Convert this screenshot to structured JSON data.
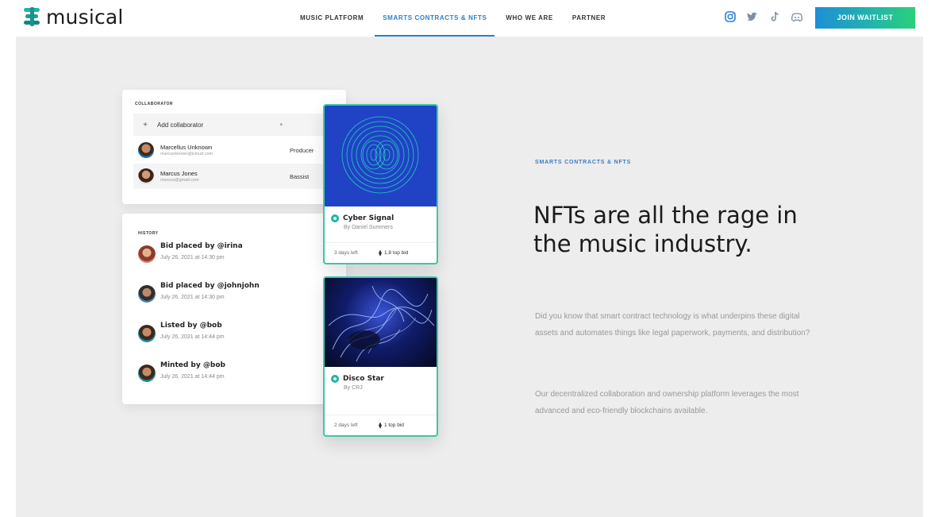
{
  "header": {
    "logo_text": "musical",
    "nav": [
      {
        "label": "MUSIC PLATFORM",
        "active": false
      },
      {
        "label": "SMARTS CONTRACTS & NFTS",
        "active": true
      },
      {
        "label": "WHO WE ARE",
        "active": false
      },
      {
        "label": "PARTNER",
        "active": false
      }
    ],
    "social_icons": [
      "instagram-icon",
      "twitter-icon",
      "tiktok-icon",
      "discord-icon"
    ],
    "join_label": "JOIN WAITLIST"
  },
  "collaborators": {
    "title": "COLLABORATOR",
    "add_label": "Add collaborator",
    "rows": [
      {
        "name": "Marcellus Unknown",
        "email": "marcunknown@icloud.com",
        "role": "Producer"
      },
      {
        "name": "Marcus Jones",
        "email": "marcus@gmail.com",
        "role": "Bassist"
      }
    ]
  },
  "history": {
    "title": "HISTORY",
    "items": [
      {
        "title": "Bid placed by @irina",
        "time": "July 26, 2021 at 14:30 pm"
      },
      {
        "title": "Bid placed by @johnjohn",
        "time": "July 26, 2021 at 14:30 pm"
      },
      {
        "title": "Listed by @bob",
        "time": "July 26, 2021 at 14:44 pm"
      },
      {
        "title": "Minted by @bob",
        "time": "July 26, 2021 at 14:44 pm"
      }
    ]
  },
  "nfts": [
    {
      "title": "Cyber Signal",
      "by": "By Daniel Summers",
      "time_left": "3 days left",
      "bid": "1.8 top bid"
    },
    {
      "title": "Disco Star",
      "by": "By CRJ",
      "time_left": "2 days left",
      "bid": "1 top bid"
    }
  ],
  "content": {
    "eyebrow": "SMARTS CONTRACTS & NFTS",
    "headline": "NFTs are all the rage in the music industry.",
    "paragraph_1": "Did you know that smart contract technology is what underpins these digital assets and automates things like legal paperwork, payments, and distribution?",
    "paragraph_2": "Our decentralized collaboration and ownership platform leverages the most advanced and eco-friendly blockchains available."
  },
  "colors": {
    "accent_blue": "#2b7fd0",
    "teal": "#1fb4a7",
    "nft_border": "#3cc7a8",
    "panel_bg": "#ededed"
  }
}
